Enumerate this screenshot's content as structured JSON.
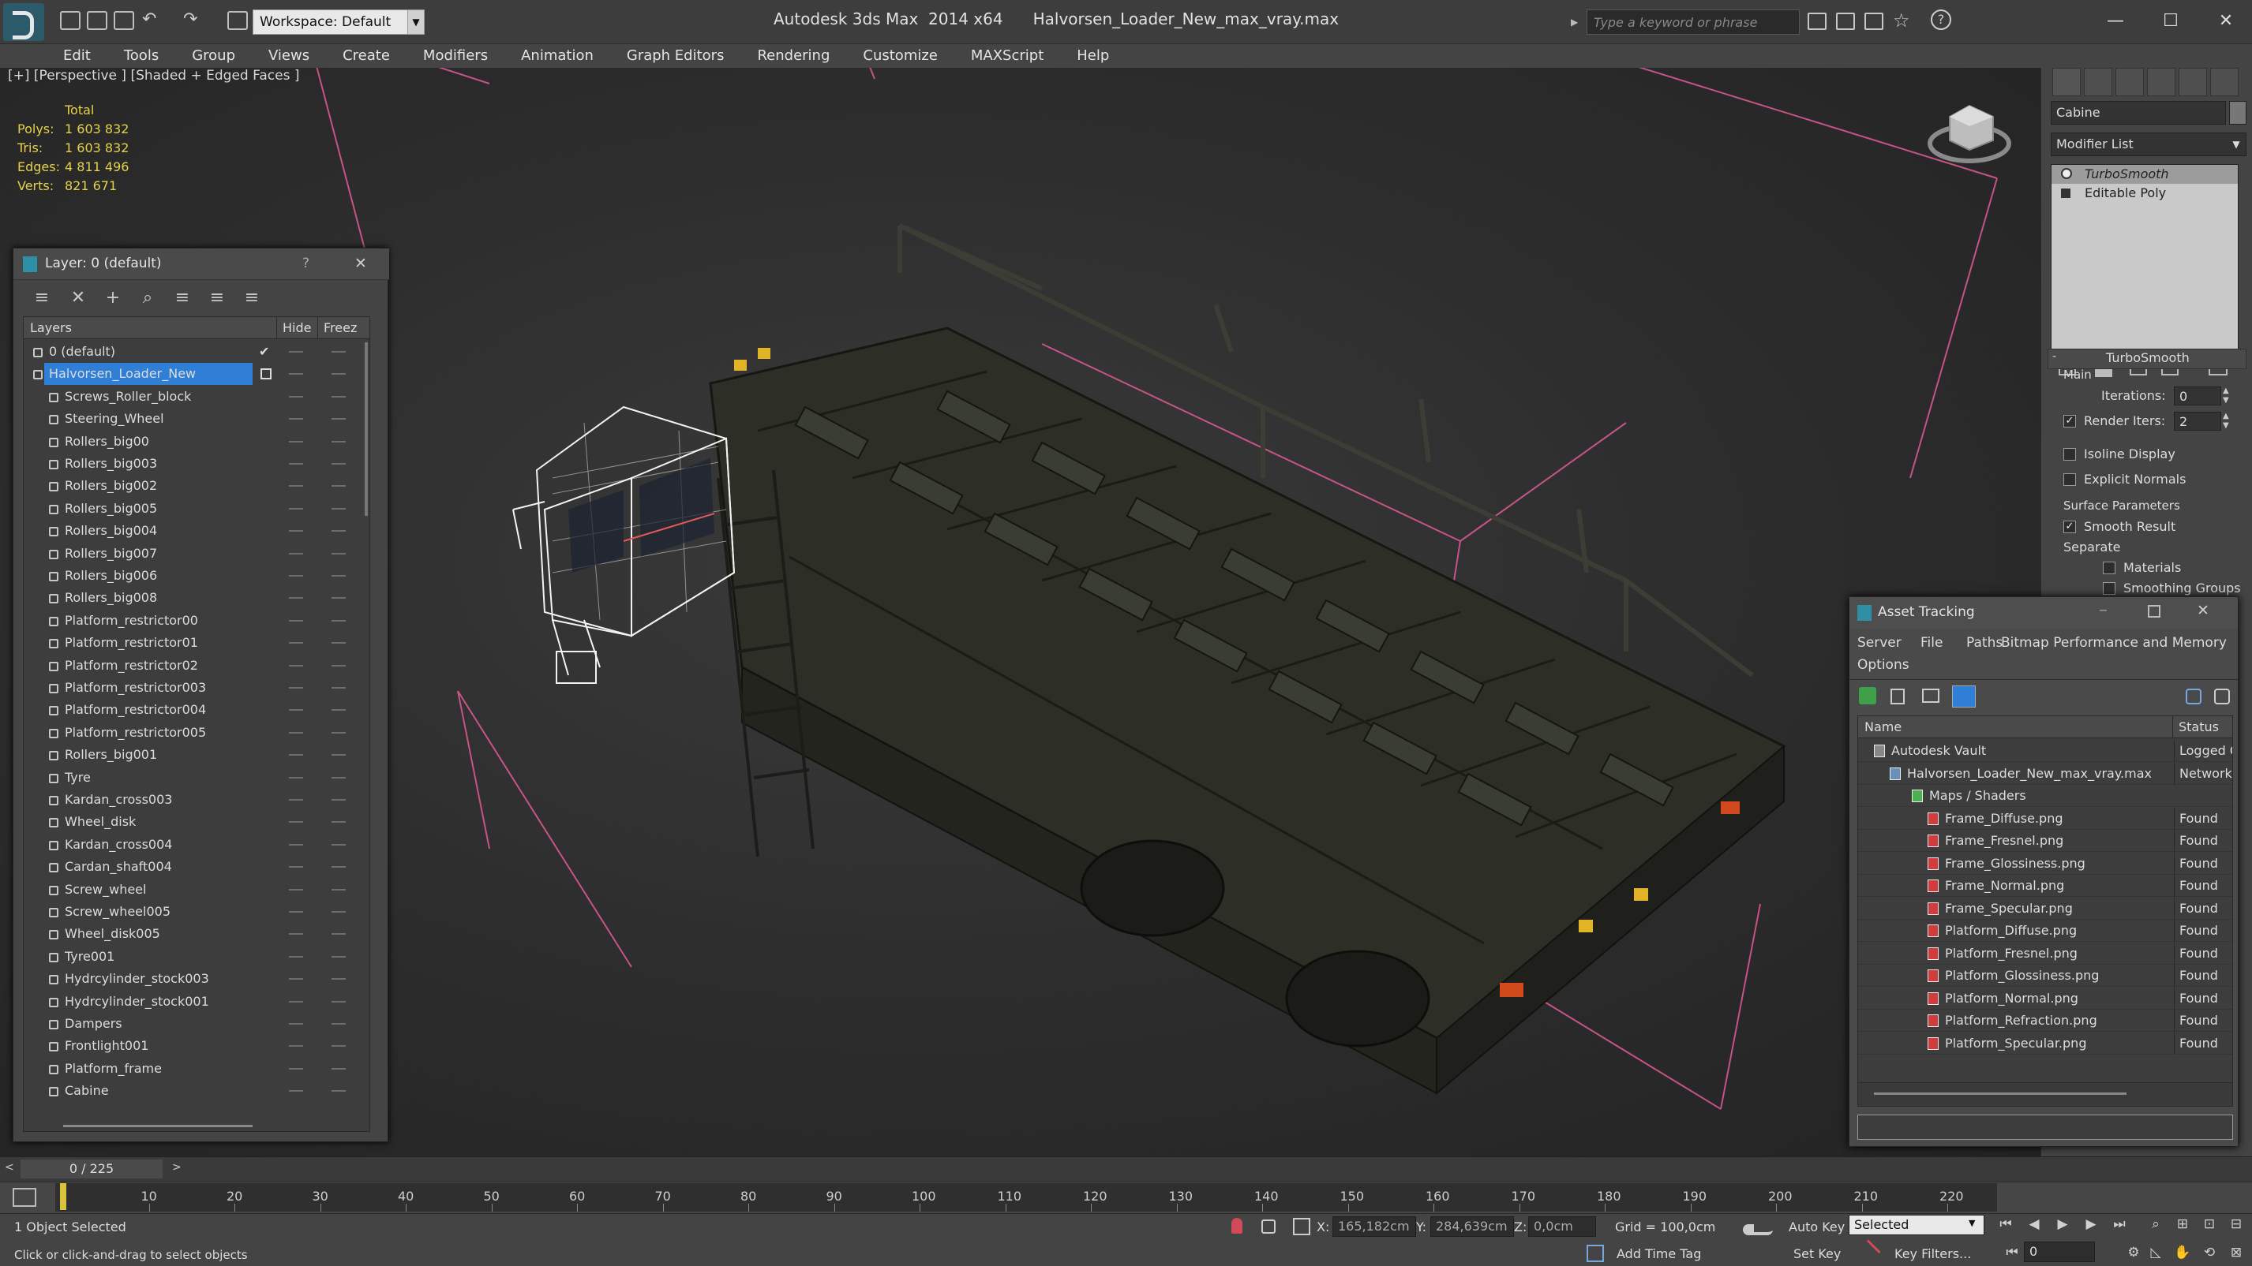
{
  "titlebar": {
    "workspace_label": "Workspace: Default",
    "app_name": "Autodesk 3ds Max  2014 x64",
    "file_name": "Halvorsen_Loader_New_max_vray.max",
    "search_placeholder": "Type a keyword or phrase",
    "minimize": "—",
    "maximize": "☐",
    "close": "✕"
  },
  "menu": [
    "Edit",
    "Tools",
    "Group",
    "Views",
    "Create",
    "Modifiers",
    "Animation",
    "Graph Editors",
    "Rendering",
    "Customize",
    "MAXScript",
    "Help"
  ],
  "viewport": {
    "label": "[+] [Perspective ] [Shaded + Edged Faces ]",
    "stats": {
      "header": "Total",
      "rows": [
        {
          "label": "Polys:",
          "value": "1 603 832"
        },
        {
          "label": "Tris:",
          "value": "1 603 832"
        },
        {
          "label": "Edges:",
          "value": "4 811 496"
        },
        {
          "label": "Verts:",
          "value": "821 671"
        }
      ]
    }
  },
  "command_panel": {
    "object_name": "Cabine",
    "modifier_list": "Modifier List",
    "stack": [
      "TurboSmooth",
      "Editable Poly"
    ],
    "rollout_title": "TurboSmooth",
    "main_label": "Main",
    "iterations_label": "Iterations:",
    "iterations_value": "0",
    "render_iters_label": "Render Iters:",
    "render_iters_value": "2",
    "isoline_label": "Isoline Display",
    "explicit_normals_label": "Explicit Normals",
    "surface_params_label": "Surface Parameters",
    "smooth_result_label": "Smooth Result",
    "separate_label": "Separate",
    "materials_label": "Materials",
    "smoothing_groups_label": "Smoothing Groups"
  },
  "layer_panel": {
    "title": "Layer: 0 (default)",
    "help": "?",
    "close": "✕",
    "col_layers": "Layers",
    "col_hide": "Hide",
    "col_freeze": "Freez",
    "layers": [
      {
        "name": "0 (default)",
        "level": 0
      },
      {
        "name": "Halvorsen_Loader_New",
        "level": 0,
        "selected": true
      },
      {
        "name": "Screws_Roller_block",
        "level": 1
      },
      {
        "name": "Steering_Wheel",
        "level": 1
      },
      {
        "name": "Rollers_big00",
        "level": 1
      },
      {
        "name": "Rollers_big003",
        "level": 1
      },
      {
        "name": "Rollers_big002",
        "level": 1
      },
      {
        "name": "Rollers_big005",
        "level": 1
      },
      {
        "name": "Rollers_big004",
        "level": 1
      },
      {
        "name": "Rollers_big007",
        "level": 1
      },
      {
        "name": "Rollers_big006",
        "level": 1
      },
      {
        "name": "Rollers_big008",
        "level": 1
      },
      {
        "name": "Platform_restrictor00",
        "level": 1
      },
      {
        "name": "Platform_restrictor01",
        "level": 1
      },
      {
        "name": "Platform_restrictor02",
        "level": 1
      },
      {
        "name": "Platform_restrictor003",
        "level": 1
      },
      {
        "name": "Platform_restrictor004",
        "level": 1
      },
      {
        "name": "Platform_restrictor005",
        "level": 1
      },
      {
        "name": "Rollers_big001",
        "level": 1
      },
      {
        "name": "Tyre",
        "level": 1
      },
      {
        "name": "Kardan_cross003",
        "level": 1
      },
      {
        "name": "Wheel_disk",
        "level": 1
      },
      {
        "name": "Kardan_cross004",
        "level": 1
      },
      {
        "name": "Cardan_shaft004",
        "level": 1
      },
      {
        "name": "Screw_wheel",
        "level": 1
      },
      {
        "name": "Screw_wheel005",
        "level": 1
      },
      {
        "name": "Wheel_disk005",
        "level": 1
      },
      {
        "name": "Tyre001",
        "level": 1
      },
      {
        "name": "Hydrcylinder_stock003",
        "level": 1
      },
      {
        "name": "Hydrcylinder_stock001",
        "level": 1
      },
      {
        "name": "Dampers",
        "level": 1
      },
      {
        "name": "Frontlight001",
        "level": 1
      },
      {
        "name": "Platform_frame",
        "level": 1
      },
      {
        "name": "Cabine",
        "level": 1
      }
    ]
  },
  "asset_tracking": {
    "title": "Asset Tracking",
    "menu": [
      "Server",
      "File",
      "Paths",
      "Bitmap Performance and Memory",
      "Options"
    ],
    "col_name": "Name",
    "col_status": "Status",
    "rows": [
      {
        "name": "Autodesk Vault",
        "status": "Logged O",
        "level": 0
      },
      {
        "name": "Halvorsen_Loader_New_max_vray.max",
        "status": "Network I",
        "level": 1
      },
      {
        "name": "Maps / Shaders",
        "status": "",
        "level": 2
      },
      {
        "name": "Frame_Diffuse.png",
        "status": "Found",
        "level": 3
      },
      {
        "name": "Frame_Fresnel.png",
        "status": "Found",
        "level": 3
      },
      {
        "name": "Frame_Glossiness.png",
        "status": "Found",
        "level": 3
      },
      {
        "name": "Frame_Normal.png",
        "status": "Found",
        "level": 3
      },
      {
        "name": "Frame_Specular.png",
        "status": "Found",
        "level": 3
      },
      {
        "name": "Platform_Diffuse.png",
        "status": "Found",
        "level": 3
      },
      {
        "name": "Platform_Fresnel.png",
        "status": "Found",
        "level": 3
      },
      {
        "name": "Platform_Glossiness.png",
        "status": "Found",
        "level": 3
      },
      {
        "name": "Platform_Normal.png",
        "status": "Found",
        "level": 3
      },
      {
        "name": "Platform_Refraction.png",
        "status": "Found",
        "level": 3
      },
      {
        "name": "Platform_Specular.png",
        "status": "Found",
        "level": 3
      }
    ]
  },
  "timeline": {
    "frame_counter": "0 / 225",
    "ticks": [
      "10",
      "20",
      "30",
      "40",
      "50",
      "60",
      "70",
      "80",
      "90",
      "100",
      "110",
      "120",
      "130",
      "140",
      "150",
      "160",
      "170",
      "180",
      "190",
      "200",
      "210",
      "220"
    ]
  },
  "status": {
    "selection": "1 Object Selected",
    "prompt": "Click or click-and-drag to select objects",
    "x_label": "X:",
    "x_value": "165,182cm",
    "y_label": "Y:",
    "y_value": "284,639cm",
    "z_label": "Z:",
    "z_value": "0,0cm",
    "grid": "Grid = 100,0cm",
    "add_time_tag": "Add Time Tag",
    "auto_key": "Auto Key",
    "set_key": "Set Key",
    "selected_option": "Selected",
    "key_filters": "Key Filters...",
    "frame_value": "0"
  },
  "colors": {
    "accent_blue": "#2f7fd6",
    "stats_yellow": "#e6d24a",
    "grid_pink": "#e05a9a"
  }
}
